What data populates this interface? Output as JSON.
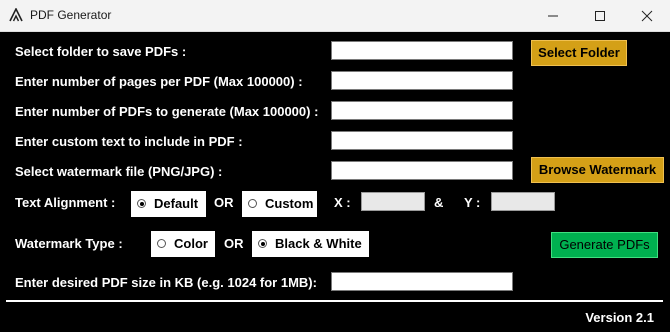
{
  "window": {
    "title": "PDF Generator",
    "icon": "app-logo-icon"
  },
  "controls": {
    "minimize_icon": "minimize-icon",
    "maximize_icon": "maximize-icon",
    "close_icon": "close-icon"
  },
  "form": {
    "folder_label": "Select folder to save PDFs :",
    "folder_value": "",
    "select_folder_button": "Select Folder",
    "pages_label": "Enter number of pages per PDF (Max 100000) :",
    "pages_value": "",
    "count_label": "Enter number of PDFs to generate (Max 100000) :",
    "count_value": "",
    "custom_text_label": "Enter custom text to include in PDF :",
    "custom_text_value": "",
    "watermark_file_label": "Select watermark file (PNG/JPG) :",
    "watermark_file_value": "",
    "browse_watermark_button": "Browse Watermark",
    "alignment_label": "Text Alignment :",
    "alignment_default": "Default",
    "alignment_or": "OR",
    "alignment_custom": "Custom",
    "alignment_selected": "Default",
    "x_label": "X :",
    "x_value": "",
    "amp": "&",
    "y_label": "Y :",
    "y_value": "",
    "watermark_type_label": "Watermark Type :",
    "watermark_color": "Color",
    "watermark_or": "OR",
    "watermark_bw": "Black & White",
    "watermark_selected": "Black & White",
    "generate_button": "Generate PDFs",
    "size_label": "Enter desired PDF size in KB (e.g. 1024 for 1MB):",
    "size_value": ""
  },
  "footer": {
    "version": "Version 2.1"
  },
  "colors": {
    "background": "#000000",
    "gold_button": "#d4a017",
    "green_button": "#00b050",
    "titlebar": "#f3f3f3"
  }
}
